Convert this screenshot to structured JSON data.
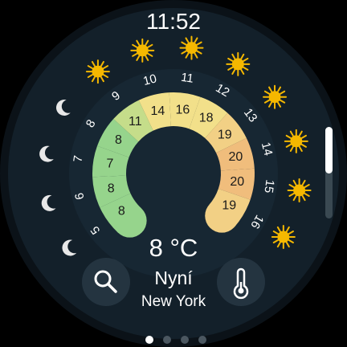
{
  "time": "11:52",
  "current": {
    "temperature": "8 °C",
    "label": "Nyní",
    "location": "New York"
  },
  "hours": [
    {
      "hour": "5",
      "temp": "8",
      "condition": "moon"
    },
    {
      "hour": "6",
      "temp": "8",
      "condition": "moon"
    },
    {
      "hour": "7",
      "temp": "7",
      "condition": "moon"
    },
    {
      "hour": "8",
      "temp": "8",
      "condition": "moon"
    },
    {
      "hour": "9",
      "temp": "11",
      "condition": "sun"
    },
    {
      "hour": "10",
      "temp": "14",
      "condition": "sun"
    },
    {
      "hour": "11",
      "temp": "16",
      "condition": "sun"
    },
    {
      "hour": "12",
      "temp": "18",
      "condition": "sun"
    },
    {
      "hour": "13",
      "temp": "19",
      "condition": "sun"
    },
    {
      "hour": "14",
      "temp": "20",
      "condition": "sun"
    },
    {
      "hour": "15",
      "temp": "20",
      "condition": "sun"
    },
    {
      "hour": "16",
      "temp": "19",
      "condition": "sun"
    }
  ],
  "center_icon": "crescent-moon-icon",
  "buttons": {
    "left": "search-icon",
    "right": "thermometer-icon"
  },
  "pager": {
    "count": 4,
    "active": 0
  },
  "scroll_fraction": 0.5,
  "colors": {
    "background": "#13202a",
    "bezel": "#0d161d",
    "accent_green": "#96d48c",
    "accent_yellow": "#f2e08a",
    "accent_orange": "#f0bd7c",
    "sun": "#f5b800",
    "moon": "#e8e8e8"
  }
}
